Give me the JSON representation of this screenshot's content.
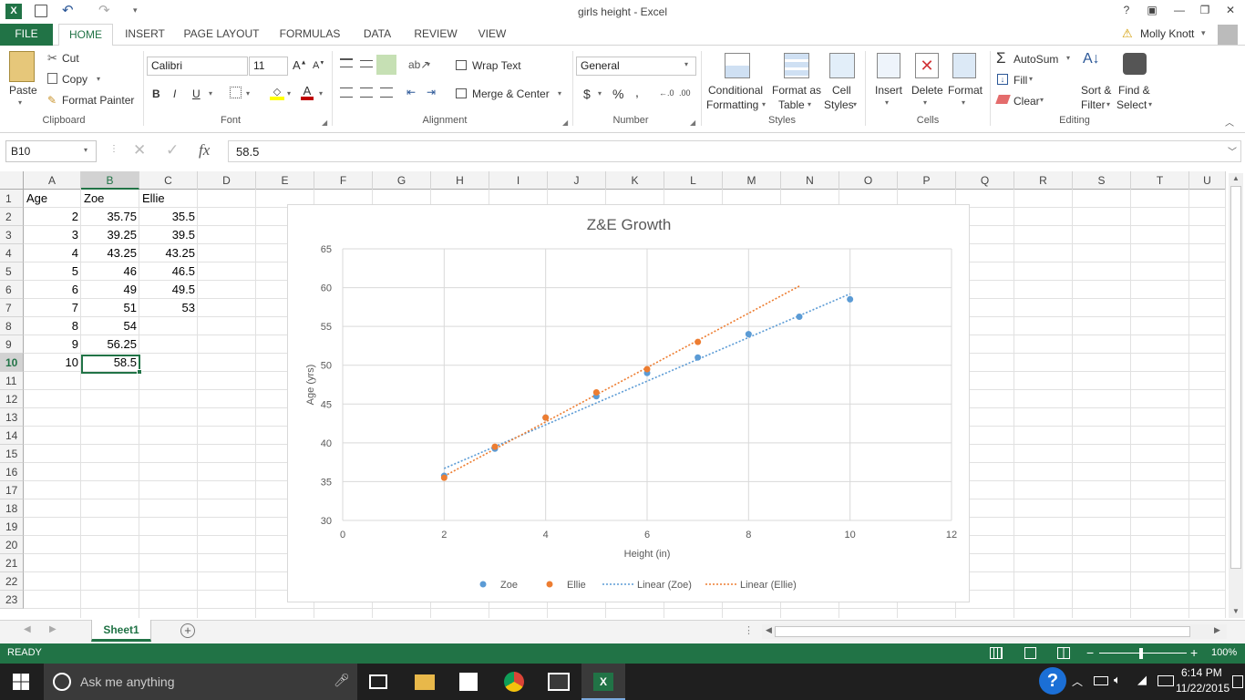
{
  "window": {
    "title": "girls height - Excel",
    "user": "Molly Knott"
  },
  "tabs": [
    "FILE",
    "HOME",
    "INSERT",
    "PAGE LAYOUT",
    "FORMULAS",
    "DATA",
    "REVIEW",
    "VIEW"
  ],
  "ribbon": {
    "clipboard": {
      "paste": "Paste",
      "cut": "Cut",
      "copy": "Copy",
      "format_painter": "Format Painter",
      "label": "Clipboard"
    },
    "font": {
      "name": "Calibri",
      "size": "11",
      "label": "Font",
      "bold": "B",
      "italic": "I",
      "underline": "U"
    },
    "alignment": {
      "wrap": "Wrap Text",
      "merge": "Merge & Center",
      "label": "Alignment"
    },
    "number": {
      "format": "General",
      "currency": "$",
      "percent": "%",
      "comma": ",",
      "label": "Number"
    },
    "styles": {
      "conditional": "Conditional",
      "conditional2": "Formatting",
      "format_table": "Format as",
      "format_table2": "Table",
      "cell_styles": "Cell",
      "cell_styles2": "Styles",
      "label": "Styles"
    },
    "cells": {
      "insert": "Insert",
      "delete": "Delete",
      "format": "Format",
      "label": "Cells"
    },
    "editing": {
      "autosum": "AutoSum",
      "fill": "Fill",
      "clear": "Clear",
      "sort": "Sort &",
      "sort2": "Filter",
      "find": "Find &",
      "find2": "Select",
      "label": "Editing"
    }
  },
  "formula_bar": {
    "name_box": "B10",
    "value": "58.5",
    "fx": "fx"
  },
  "columns": [
    "A",
    "B",
    "C",
    "D",
    "E",
    "F",
    "G",
    "H",
    "I",
    "J",
    "K",
    "L",
    "M",
    "N",
    "O",
    "P",
    "Q",
    "R",
    "S",
    "T",
    "U"
  ],
  "rows": [
    "1",
    "2",
    "3",
    "4",
    "5",
    "6",
    "7",
    "8",
    "9",
    "10",
    "11",
    "12",
    "13",
    "14",
    "15",
    "16",
    "17",
    "18",
    "19",
    "20",
    "21",
    "22",
    "23"
  ],
  "sheet": {
    "headers": [
      "Age",
      "Zoe",
      "Ellie"
    ],
    "data": [
      [
        "2",
        "35.75",
        "35.5"
      ],
      [
        "3",
        "39.25",
        "39.5"
      ],
      [
        "4",
        "43.25",
        "43.25"
      ],
      [
        "5",
        "46",
        "46.5"
      ],
      [
        "6",
        "49",
        "49.5"
      ],
      [
        "7",
        "51",
        "53"
      ],
      [
        "8",
        "54",
        ""
      ],
      [
        "9",
        "56.25",
        ""
      ],
      [
        "10",
        "58.5",
        ""
      ]
    ]
  },
  "chart_data": {
    "type": "scatter",
    "title": "Z&E Growth",
    "xlabel": "Height (in)",
    "ylabel": "Age (yrs)",
    "xlim": [
      0,
      12
    ],
    "ylim": [
      30,
      65
    ],
    "xticks": [
      "0",
      "2",
      "4",
      "6",
      "8",
      "10",
      "12"
    ],
    "yticks": [
      "30",
      "35",
      "40",
      "45",
      "50",
      "55",
      "60",
      "65"
    ],
    "grid": true,
    "legend": "bottom",
    "series": [
      {
        "name": "Zoe",
        "color": "#5b9bd5",
        "x": [
          2,
          3,
          4,
          5,
          6,
          7,
          8,
          9,
          10
        ],
        "y": [
          35.75,
          39.25,
          43.25,
          46,
          49,
          51,
          54,
          56.25,
          58.5
        ]
      },
      {
        "name": "Ellie",
        "color": "#ed7d31",
        "x": [
          2,
          3,
          4,
          5,
          6,
          7
        ],
        "y": [
          35.5,
          39.5,
          43.25,
          46.5,
          49.5,
          53
        ]
      }
    ],
    "trendlines": [
      {
        "name": "Linear (Zoe)",
        "color": "#5b9bd5",
        "x": [
          2,
          10
        ],
        "y": [
          36.7,
          59.2
        ]
      },
      {
        "name": "Linear (Ellie)",
        "color": "#ed7d31",
        "x": [
          2,
          9
        ],
        "y": [
          35.7,
          60.2
        ]
      }
    ]
  },
  "sheet_tabs": {
    "active": "Sheet1"
  },
  "status": {
    "text": "READY",
    "zoom": "100%"
  },
  "taskbar": {
    "search": "Ask me anything",
    "time": "6:14 PM",
    "date": "11/22/2015"
  },
  "colors": {
    "excel_green": "#217346"
  }
}
